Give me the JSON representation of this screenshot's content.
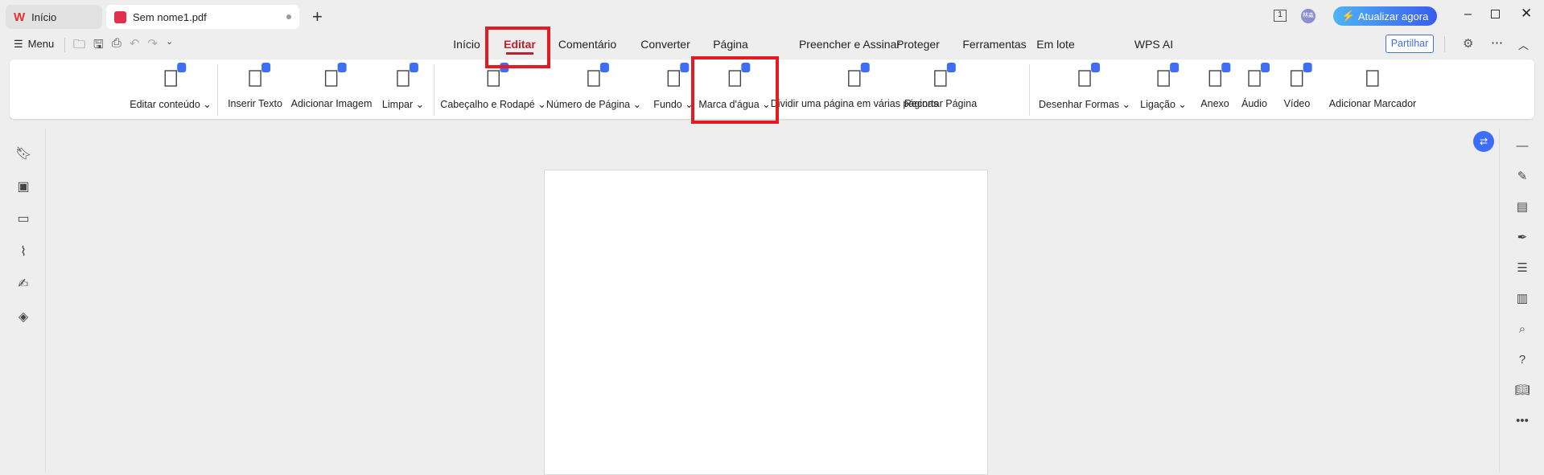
{
  "tabs": [
    {
      "label": "Início"
    },
    {
      "label": "Sem nome1.pdf"
    }
  ],
  "menu_label": "Menu",
  "ribbon_tabs": [
    "Início",
    "Editar",
    "Comentário",
    "Converter",
    "Página",
    "Preencher e Assinar",
    "Proteger",
    "Ferramentas",
    "Em lote",
    "WPS AI"
  ],
  "active_tab": "Editar",
  "update_button": "Atualizar agora",
  "share_button": "Partilhar",
  "page_count_icon": "1",
  "avatar_text": "林淼",
  "tools": [
    "Editar conteúdo",
    "Inserir Texto",
    "Adicionar Imagem",
    "Limpar",
    "Cabeçalho e Rodapé",
    "Número de Página",
    "Fundo",
    "Marca d'água",
    "Dividir uma página em várias páginas",
    "Recortar Página",
    "Desenhar Formas",
    "Ligação",
    "Anexo",
    "Áudio",
    "Vídeo",
    "Adicionar Marcador"
  ],
  "colors": {
    "accent": "#c0202f",
    "highlight": "#e41b23",
    "brand_blue": "#3d6ef5"
  }
}
